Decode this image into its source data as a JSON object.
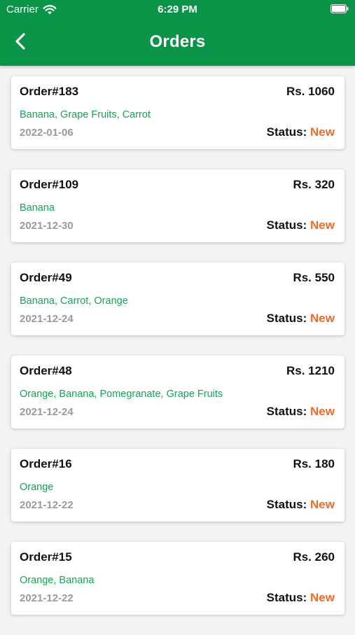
{
  "status_bar": {
    "carrier": "Carrier",
    "time": "6:29 PM",
    "wifi_icon": "wifi-icon",
    "battery_icon": "battery-icon"
  },
  "header": {
    "title": "Orders",
    "back_icon": "chevron-left-icon"
  },
  "colors": {
    "header_bg": "#0a9447",
    "items_text": "#17a354",
    "status_new": "#f06a2a"
  },
  "labels": {
    "status_prefix": "Status:"
  },
  "orders": [
    {
      "id": "Order#183",
      "amount": "Rs. 1060",
      "items": "Banana, Grape Fruits, Carrot",
      "date": "2022-01-06",
      "status": "New"
    },
    {
      "id": "Order#109",
      "amount": "Rs. 320",
      "items": "Banana",
      "date": "2021-12-30",
      "status": "New"
    },
    {
      "id": "Order#49",
      "amount": "Rs. 550",
      "items": "Banana, Carrot, Orange",
      "date": "2021-12-24",
      "status": "New"
    },
    {
      "id": "Order#48",
      "amount": "Rs. 1210",
      "items": "Orange, Banana, Pomegranate, Grape Fruits",
      "date": "2021-12-24",
      "status": "New"
    },
    {
      "id": "Order#16",
      "amount": "Rs. 180",
      "items": "Orange",
      "date": "2021-12-22",
      "status": "New"
    },
    {
      "id": "Order#15",
      "amount": "Rs. 260",
      "items": "Orange, Banana",
      "date": "2021-12-22",
      "status": "New"
    }
  ]
}
